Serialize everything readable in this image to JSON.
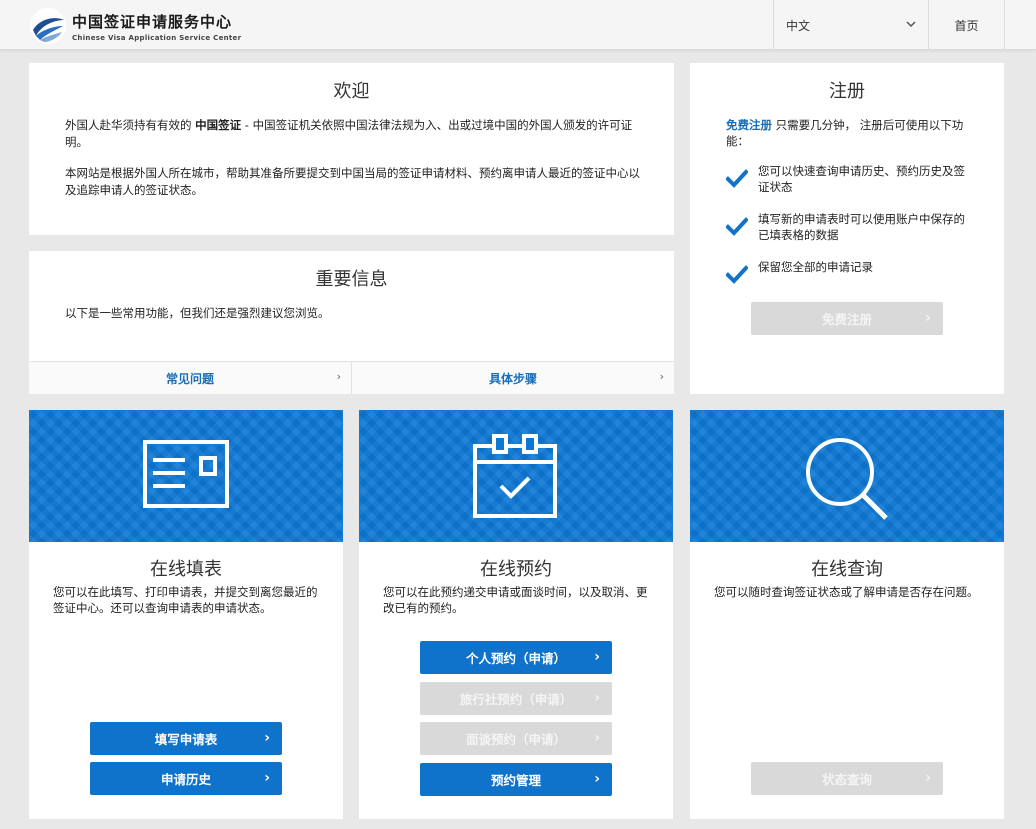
{
  "header": {
    "logo_cn": "中国签证申请服务中心",
    "logo_en": "Chinese Visa Application Service Center",
    "language": "中文",
    "home": "首页"
  },
  "welcome": {
    "title": "欢迎",
    "para1_a": "外国人赴华须持有有效的 ",
    "para1_b": "中国签证",
    "para1_c": " - 中国签证机关依照中国法律法规为入、出或过境中国的外国人颁发的许可证明。",
    "para2": "本网站是根据外国人所在城市，帮助其准备所要提交到中国当局的签证申请材料、预约离申请人最近的签证中心以及追踪申请人的签证状态。"
  },
  "info": {
    "title": "重要信息",
    "text": "以下是一些常用功能，但我们还是强烈建议您浏览。",
    "links": [
      "常见问题",
      "具体步骤"
    ]
  },
  "register": {
    "title": "注册",
    "intro_link": "免费注册",
    "intro_text": " 只需要几分钟， 注册后可使用以下功能：",
    "benefits": [
      "您可以快速查询申请历史、预约历史及签证状态",
      "填写新的申请表时可以使用账户中保存的已填表格的数据",
      "保留您全部的申请记录"
    ],
    "button": "免费注册"
  },
  "services": [
    {
      "title": "在线填表",
      "desc": "您可以在此填写、打印申请表，并提交到离您最近的签证中心。还可以查询申请表的申请状态。",
      "buttons": [
        "填写申请表",
        "申请历史"
      ]
    },
    {
      "title": "在线预约",
      "desc": "您可以在此预约递交申请或面谈时间，以及取消、更改已有的预约。",
      "buttons": [
        "个人预约（申请）",
        "旅行社预约（申请）",
        "面谈预约（申请）",
        "预约管理"
      ]
    },
    {
      "title": "在线查询",
      "desc": "您可以随时查询签证状态或了解申请是否存在问题。",
      "buttons": [
        "状态查询"
      ]
    }
  ],
  "icons": {
    "arrow": "›",
    "chevron": "⌄"
  },
  "colors": {
    "primary": "#0f73cc",
    "banner": "#0c78d4",
    "link": "#1a6eb8",
    "disabled": "#d9d9d9"
  }
}
